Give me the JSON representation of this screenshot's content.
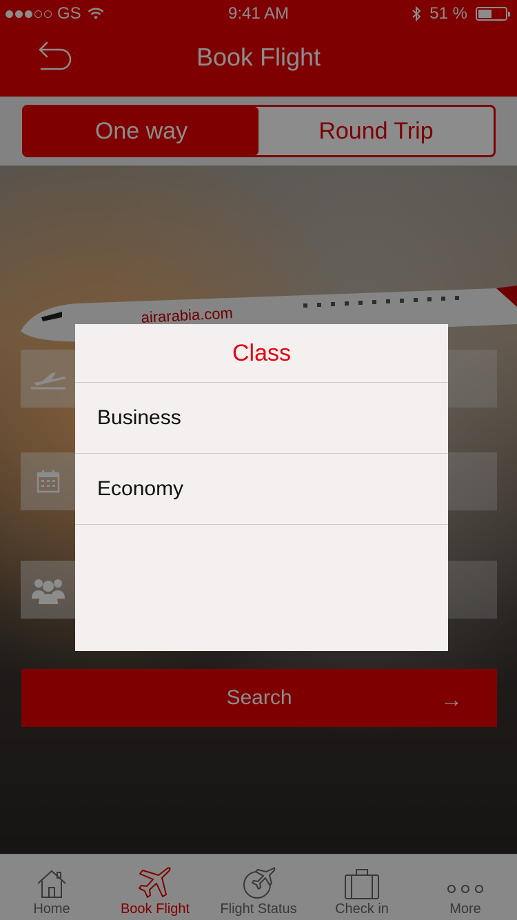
{
  "status_bar": {
    "carrier": "GS",
    "time": "9:41 AM",
    "battery": "51 %",
    "battery_level": 0.51
  },
  "header": {
    "title": "Book Flight",
    "back_icon": "back-arrow-icon"
  },
  "trip_toggle": {
    "one_way_label": "One way",
    "round_trip_label": "Round Trip",
    "selected": "One way"
  },
  "hero": {
    "plane_livery": "airarabia.com"
  },
  "form": {
    "fields": [
      {
        "icon": "plane-takeoff-icon"
      },
      {
        "icon": "calendar-icon"
      },
      {
        "icon": "passengers-icon"
      }
    ],
    "search_label": "Search",
    "search_arrow": "→"
  },
  "tabbar": {
    "items": [
      {
        "label": "Home",
        "icon": "home-icon"
      },
      {
        "label": "Book Flight",
        "icon": "airplane-icon"
      },
      {
        "label": "Flight Status",
        "icon": "flight-status-icon"
      },
      {
        "label": "Check in",
        "icon": "suitcase-icon"
      },
      {
        "label": "More",
        "icon": "more-dots-icon"
      }
    ],
    "active": "Book Flight"
  },
  "class_picker": {
    "title": "Class",
    "options": [
      "Business",
      "Economy"
    ]
  },
  "colors": {
    "brand_red": "#e50000",
    "modal_title_red": "#e30613",
    "modal_background": "#f4f0ef"
  }
}
